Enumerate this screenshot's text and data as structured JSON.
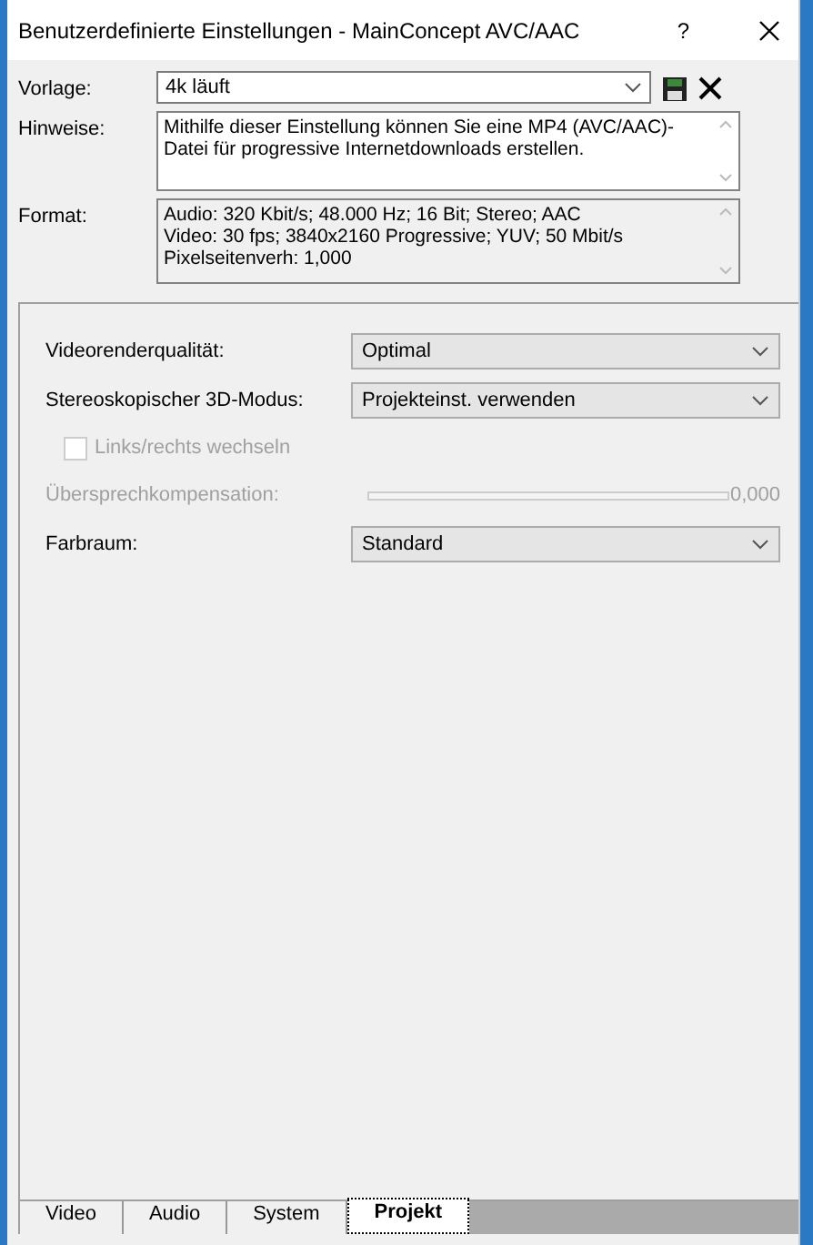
{
  "window": {
    "title": "Benutzerdefinierte Einstellungen - MainConcept AVC/AAC",
    "help": "?"
  },
  "template": {
    "label": "Vorlage:",
    "value": "4k läuft"
  },
  "notes": {
    "label": "Hinweise:",
    "text": "Mithilfe dieser Einstellung können Sie eine MP4 (AVC/AAC)-Datei für progressive Internetdownloads erstellen."
  },
  "format": {
    "label": "Format:",
    "lines": [
      "Audio: 320 Kbit/s; 48.000 Hz; 16 Bit; Stereo; AAC",
      "Video: 30 fps; 3840x2160 Progressive; YUV; 50 Mbit/s",
      "Pixelseitenverh: 1,000"
    ]
  },
  "settings": [
    {
      "kind": "dropdown",
      "label": "Videorenderqualität:",
      "value": "Optimal",
      "disabled": false
    },
    {
      "kind": "dropdown",
      "label": "Stereoskopischer 3D-Modus:",
      "value": "Projekteinst. verwenden",
      "disabled": false
    },
    {
      "kind": "checkbox",
      "label": "Links/rechts wechseln",
      "checked": false,
      "disabled": true
    },
    {
      "kind": "slider",
      "label": "Übersprechkompensation:",
      "level": 0,
      "reading": "0,000",
      "disabled": true
    },
    {
      "kind": "dropdown",
      "label": "Farbraum:",
      "value": "Standard",
      "disabled": false
    }
  ],
  "tabs": [
    {
      "label": "Video",
      "selected": false
    },
    {
      "label": "Audio",
      "selected": false
    },
    {
      "label": "System",
      "selected": false
    },
    {
      "label": "Projekt",
      "selected": true
    }
  ]
}
